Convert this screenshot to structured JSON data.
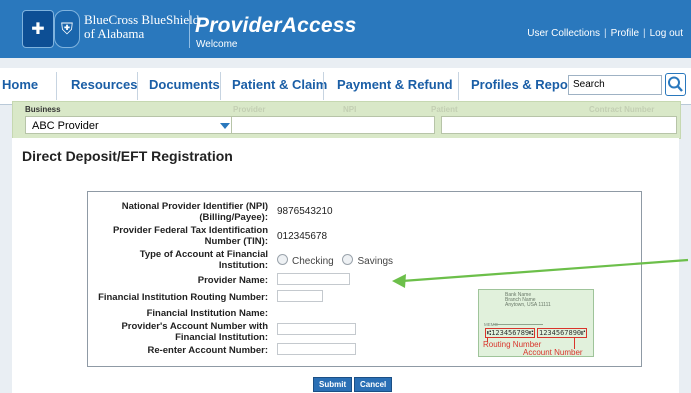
{
  "header": {
    "brand_line1": "BlueCross BlueShield",
    "brand_line2": "of Alabama",
    "app_title": "ProviderAccess",
    "welcome": "Welcome",
    "links": [
      "User Collections",
      "Profile",
      "Log out"
    ],
    "colors": {
      "header_bg": "#2a78bd",
      "filter_bg": "#d9e8c8"
    }
  },
  "nav": {
    "items": [
      "Home",
      "Resources",
      "Documents",
      "Patient & Claim",
      "Payment & Refund",
      "Profiles & Reports"
    ],
    "search_value": "Search",
    "search_icon": "magnifier-icon"
  },
  "filter": {
    "labels": [
      "Business",
      "Provider",
      "NPI",
      "Patient",
      "Contract Number"
    ],
    "business_value": "ABC Provider"
  },
  "page": {
    "title": "Direct Deposit/EFT Registration"
  },
  "form": {
    "npi_label_1": "National Provider Identifier (NPI)",
    "npi_label_2": "(Billing/Payee):",
    "npi_value": "9876543210",
    "tin_label_1": "Provider Federal Tax Identification",
    "tin_label_2": "Number (TIN):",
    "tin_value": "012345678",
    "acct_type_label_1": "Type of Account at Financial",
    "acct_type_label_2": "Institution:",
    "acct_type_options": [
      "Checking",
      "Savings"
    ],
    "provider_name_label": "Provider Name:",
    "routing_label": "Financial Institution Routing Number:",
    "fi_name_label": "Financial Institution Name:",
    "acct_num_label_1": "Provider's Account Number with",
    "acct_num_label_2": "Financial Institution:",
    "reenter_label": "Re-enter Account Number:"
  },
  "check_image": {
    "bank_lines": [
      "Bank Name",
      "Branch Name",
      "Anytown, USA 11111"
    ],
    "memo": "MEMO",
    "routing_micr": "⑆123456789⑆",
    "account_micr": "1234567890⑈",
    "routing_caption": "Routing Number",
    "account_caption": "Account Number"
  },
  "buttons": {
    "submit": "Submit",
    "cancel": "Cancel"
  },
  "annotation": {
    "arrow_color": "#6cbf4a"
  }
}
